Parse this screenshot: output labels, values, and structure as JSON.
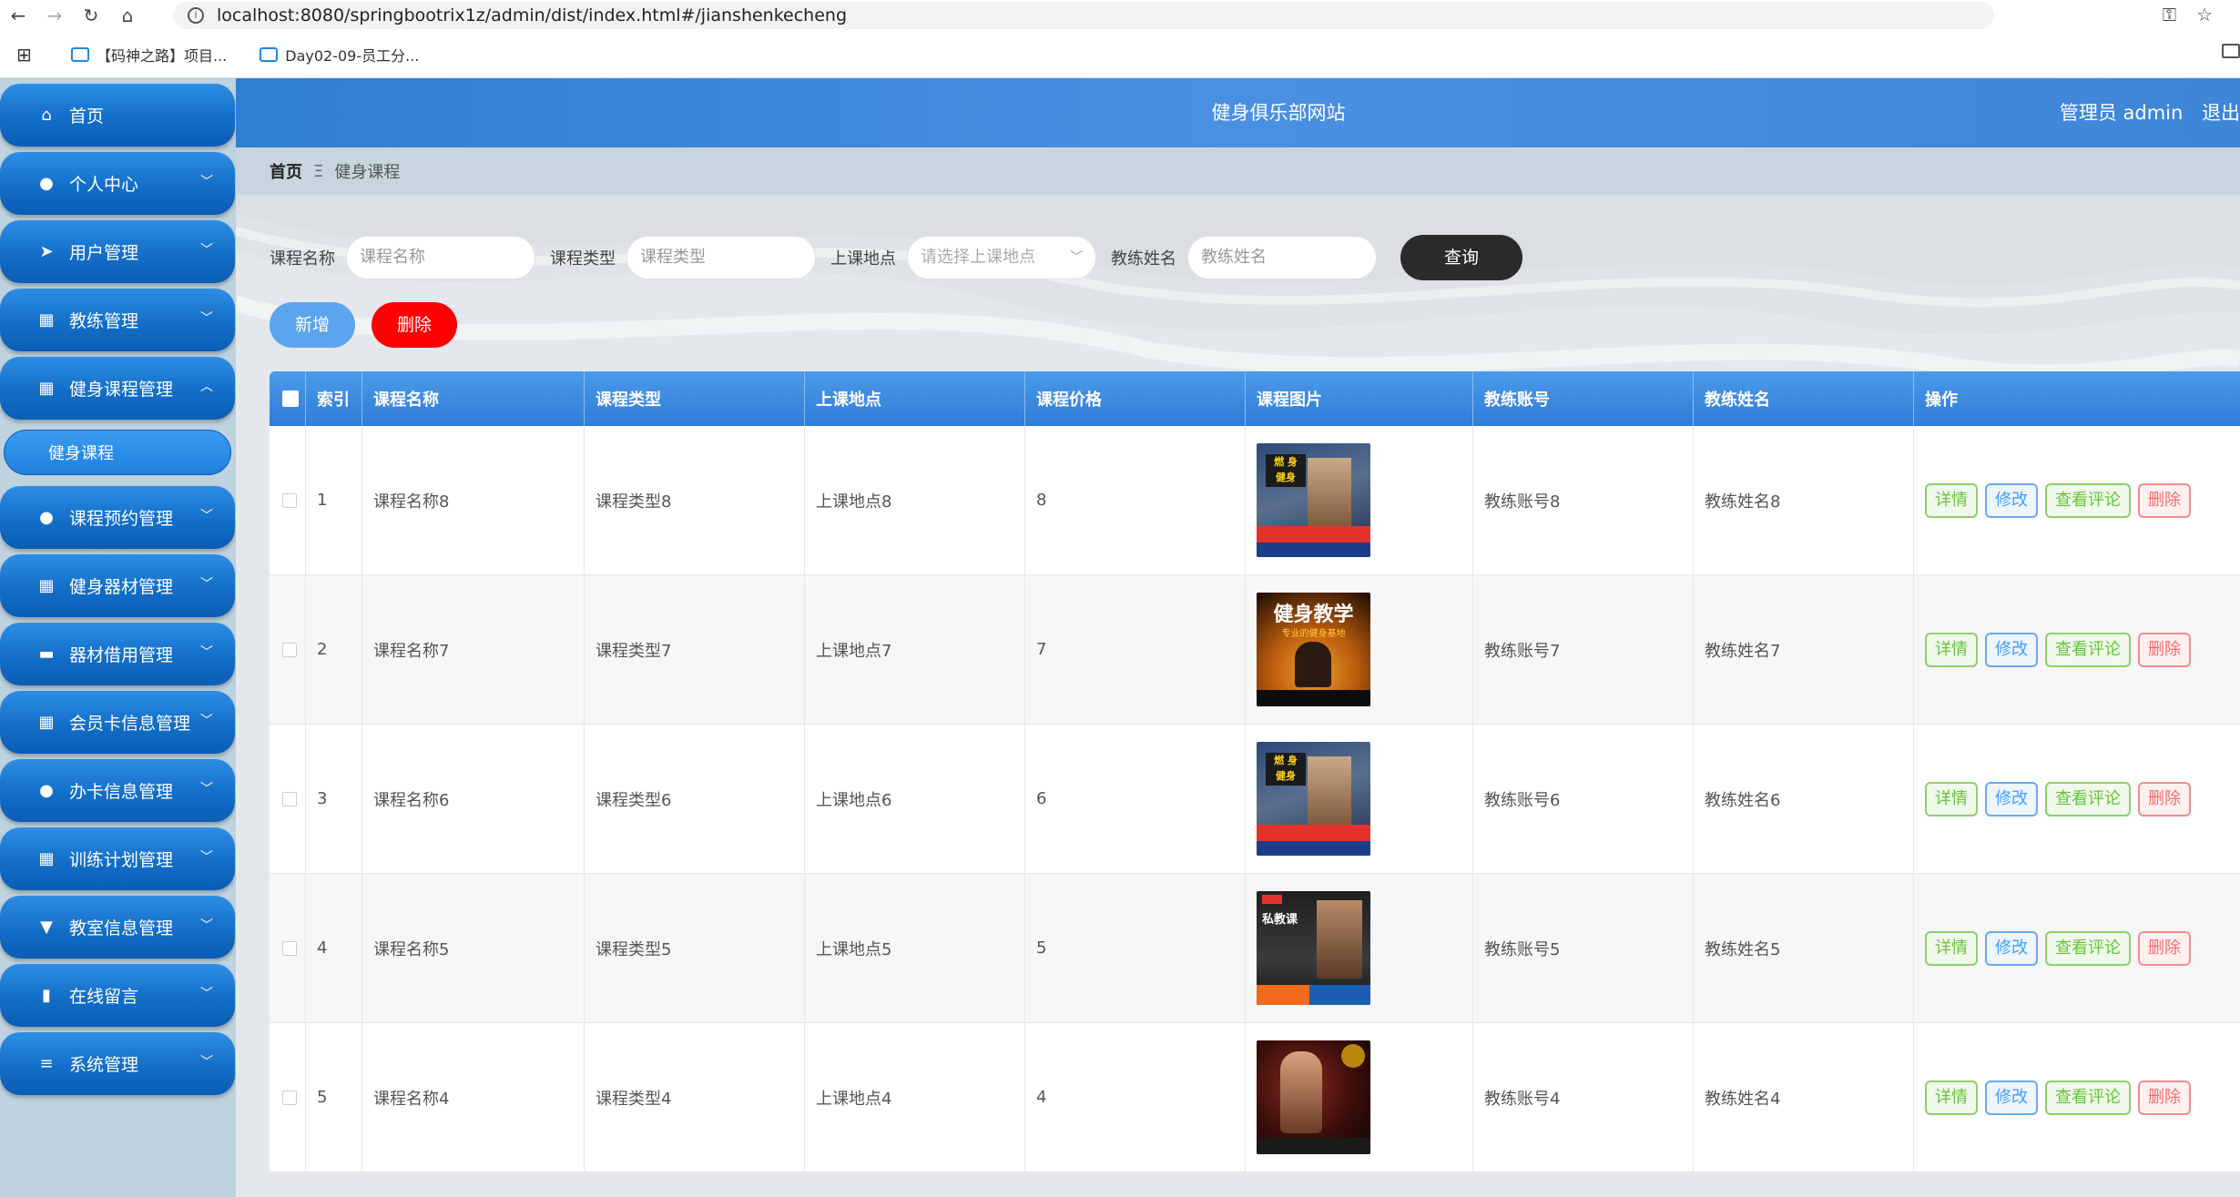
{
  "browser": {
    "url": "localhost:8080/springbootrix1z/admin/dist/index.html#/jianshenkecheng",
    "bookmarks": [
      "【码神之路】项目...",
      "Day02-09-员工分..."
    ]
  },
  "header": {
    "title": "健身俱乐部网站",
    "user": "管理员 admin",
    "logout": "退出"
  },
  "sidebar": {
    "items": [
      {
        "label": "首页",
        "icon": "home-icon"
      },
      {
        "label": "个人中心",
        "icon": "user-icon"
      },
      {
        "label": "用户管理",
        "icon": "send-icon"
      },
      {
        "label": "教练管理",
        "icon": "grid-icon"
      },
      {
        "label": "健身课程管理",
        "icon": "grid-icon"
      },
      {
        "label": "课程预约管理",
        "icon": "user-icon"
      },
      {
        "label": "健身器材管理",
        "icon": "grid-icon"
      },
      {
        "label": "器材借用管理",
        "icon": "card-icon"
      },
      {
        "label": "会员卡信息管理",
        "icon": "grid-icon"
      },
      {
        "label": "办卡信息管理",
        "icon": "user-icon"
      },
      {
        "label": "训练计划管理",
        "icon": "grid-icon"
      },
      {
        "label": "教室信息管理",
        "icon": "trophy-icon"
      },
      {
        "label": "在线留言",
        "icon": "chart-icon"
      },
      {
        "label": "系统管理",
        "icon": "list-icon"
      }
    ],
    "sub_active": "健身课程"
  },
  "breadcrumb": {
    "home": "首页",
    "current": "健身课程"
  },
  "search": {
    "name_label": "课程名称",
    "name_placeholder": "课程名称",
    "type_label": "课程类型",
    "type_placeholder": "课程类型",
    "place_label": "上课地点",
    "place_placeholder": "请选择上课地点",
    "coach_label": "教练姓名",
    "coach_placeholder": "教练姓名",
    "query": "查询"
  },
  "actions": {
    "add": "新增",
    "delete": "删除"
  },
  "table": {
    "headers": [
      "索引",
      "课程名称",
      "课程类型",
      "上课地点",
      "课程价格",
      "课程图片",
      "教练账号",
      "教练姓名",
      "操作"
    ],
    "rows": [
      {
        "index": "1",
        "name": "课程名称8",
        "type": "课程类型8",
        "place": "上课地点8",
        "price": "8",
        "coach_account": "教练账号8",
        "coach_name": "教练姓名8",
        "image": "fitness-poster-a"
      },
      {
        "index": "2",
        "name": "课程名称7",
        "type": "课程类型7",
        "place": "上课地点7",
        "price": "7",
        "coach_account": "教练账号7",
        "coach_name": "教练姓名7",
        "image": "fitness-poster-b"
      },
      {
        "index": "3",
        "name": "课程名称6",
        "type": "课程类型6",
        "place": "上课地点6",
        "price": "6",
        "coach_account": "教练账号6",
        "coach_name": "教练姓名6",
        "image": "fitness-poster-a"
      },
      {
        "index": "4",
        "name": "课程名称5",
        "type": "课程类型5",
        "place": "上课地点5",
        "price": "5",
        "coach_account": "教练账号5",
        "coach_name": "教练姓名5",
        "image": "fitness-poster-c"
      },
      {
        "index": "5",
        "name": "课程名称4",
        "type": "课程类型4",
        "place": "上课地点4",
        "price": "4",
        "coach_account": "教练账号4",
        "coach_name": "教练姓名4",
        "image": "fitness-poster-d"
      }
    ],
    "row_actions": {
      "detail": "详情",
      "edit": "修改",
      "comments": "查看评论",
      "delete": "删除"
    }
  },
  "colors": {
    "header": "#3d86d8",
    "sidebar_button": "#136ec8",
    "sidebar_bg": "#bed2df",
    "delete_red": "#ff0000",
    "query_dark": "#2b2b2b"
  }
}
